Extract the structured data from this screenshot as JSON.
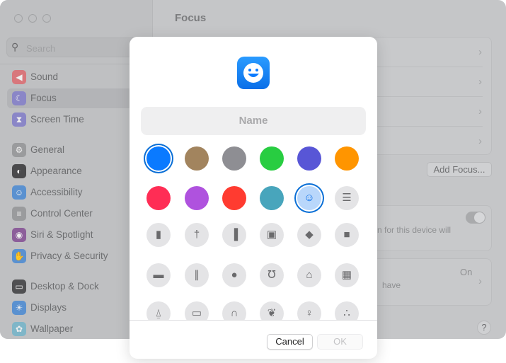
{
  "window": {
    "traffic_lights": [
      "close",
      "minimize",
      "zoom"
    ]
  },
  "sidebar": {
    "search_placeholder": "Search",
    "items": [
      {
        "label": "Sound",
        "icon": "speaker-icon",
        "color": "#d8777c",
        "selected": false
      },
      {
        "label": "Focus",
        "icon": "moon-icon",
        "color": "#8a86c7",
        "selected": true
      },
      {
        "label": "Screen Time",
        "icon": "hourglass-icon",
        "color": "#8a86c7",
        "selected": false
      },
      {
        "label": "General",
        "icon": "gear-icon",
        "color": "#9a9b9d",
        "selected": false
      },
      {
        "label": "Appearance",
        "icon": "appearance-icon",
        "color": "#4a4a4c",
        "selected": false
      },
      {
        "label": "Accessibility",
        "icon": "accessibility-icon",
        "color": "#5a91d0",
        "selected": false
      },
      {
        "label": "Control Center",
        "icon": "control-center-icon",
        "color": "#9a9b9d",
        "selected": false
      },
      {
        "label": "Siri & Spotlight",
        "icon": "siri-icon",
        "color": "#8c5e9a",
        "selected": false
      },
      {
        "label": "Privacy & Security",
        "icon": "hand-icon",
        "color": "#5a91d0",
        "selected": false
      },
      {
        "label": "Desktop & Dock",
        "icon": "dock-icon",
        "color": "#505052",
        "selected": false
      },
      {
        "label": "Displays",
        "icon": "sun-icon",
        "color": "#5a91d0",
        "selected": false
      },
      {
        "label": "Wallpaper",
        "icon": "flower-icon",
        "color": "#7fb6c8",
        "selected": false
      }
    ]
  },
  "main": {
    "title": "Focus",
    "add_focus_label": "Add Focus...",
    "share_text": "n for this device will",
    "status_value": "On",
    "status_text": "have",
    "help_label": "?"
  },
  "dialog": {
    "name_placeholder": "Name",
    "colors": [
      "#0a7aff",
      "#a2845e",
      "#8e8e93",
      "#28cd41",
      "#5856d6",
      "#ff9500",
      "#ff2d55",
      "#af52de",
      "#ff3b30",
      "#48a5bc"
    ],
    "selected_color": "#0a7aff",
    "extra_row2": [
      {
        "icon": "smiley-icon",
        "selected": true
      },
      {
        "icon": "list-icon",
        "selected": false
      }
    ],
    "icons": [
      "bookmark-icon",
      "pin-icon",
      "books-icon",
      "gift-icon",
      "graduation-cap-icon",
      "document-icon",
      "credit-card-icon",
      "fork-knife-icon",
      "pills-icon",
      "stethoscope-icon",
      "house-icon",
      "building-icon",
      "bank-icon",
      "desktop-icon",
      "headphones-icon",
      "leaf-icon",
      "person-icon",
      "paw-icon"
    ],
    "cancel_label": "Cancel",
    "ok_label": "OK"
  }
}
